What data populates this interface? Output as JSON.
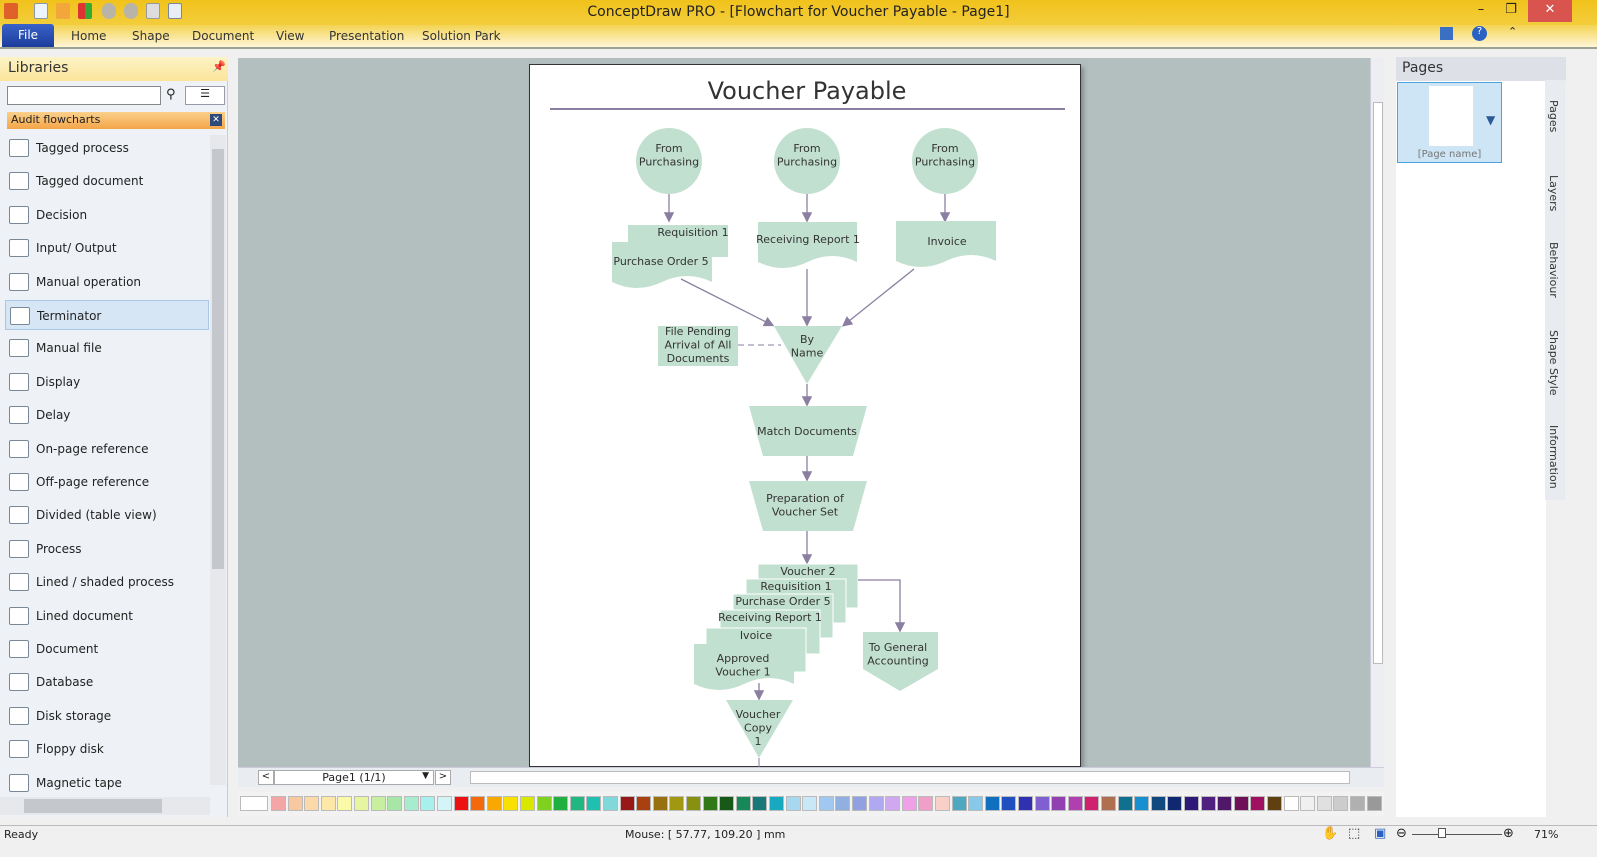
{
  "app": {
    "title": "ConceptDraw PRO - [Flowchart for Voucher Payable - Page1]"
  },
  "ribbon": {
    "file": "File",
    "tabs": [
      "Home",
      "Shape",
      "Document",
      "View",
      "Presentation",
      "Solution Park"
    ]
  },
  "window_controls": {
    "minimize": "–",
    "restore": "❐",
    "close": "✕"
  },
  "libraries": {
    "title": "Libraries",
    "search_value": "",
    "category": "Audit flowcharts",
    "items": [
      "Tagged process",
      "Tagged document",
      "Decision",
      "Input/ Output",
      "Manual operation",
      "Terminator",
      "Manual file",
      "Display",
      "Delay",
      "On-page reference",
      "Off-page reference",
      "Divided (table view)",
      "Process",
      "Lined / shaded process",
      "Lined document",
      "Document",
      "Database",
      "Disk storage",
      "Floppy disk",
      "Magnetic tape"
    ],
    "selected": "Terminator"
  },
  "diagram": {
    "title": "Voucher Payable",
    "sources": [
      "From Purchasing",
      "From Purchasing",
      "From Purchasing"
    ],
    "requisition": "Requisition 1",
    "purchase_order": "Purchase Order 5",
    "receiving_report": "Receiving Report 1",
    "invoice": "Invoice",
    "file_pending": [
      "File Pending",
      "Arrival of All",
      "Documents"
    ],
    "by_name": [
      "By",
      "Name"
    ],
    "match": "Match Documents",
    "preparation": [
      "Preparation of",
      "Voucher Set"
    ],
    "stack": [
      "Voucher 2",
      "Requisition 1",
      "Purchase Order 5",
      "Receiving Report 1",
      "Ivoice"
    ],
    "approved": [
      "Approved",
      "Voucher 1"
    ],
    "general": [
      "To General",
      "Accounting"
    ],
    "copy": [
      "Voucher",
      "Copy",
      "1"
    ],
    "fill": "#c2e0d0",
    "line": "#8a7fa0"
  },
  "navigator": {
    "prev": "<",
    "page": "Page1 (1/1)",
    "next": ">"
  },
  "palette": [
    "#f4a6a6",
    "#f8c8a0",
    "#fbd9a8",
    "#fde8a8",
    "#fafaa8",
    "#e6f5a0",
    "#c8eea0",
    "#a8e6a8",
    "#a8ecd0",
    "#a8f0ee",
    "#d4f4f8",
    "#ee1111",
    "#f46a0a",
    "#f8a800",
    "#f8e000",
    "#d8e800",
    "#80d020",
    "#20b040",
    "#20b880",
    "#20c0b0",
    "#80d8d8",
    "#981818",
    "#a84010",
    "#987010",
    "#a09810",
    "#889010",
    "#307818",
    "#185818",
    "#188858",
    "#187878",
    "#18a8c0",
    "#a8d8f0",
    "#c8e8f8",
    "#a0c8f0",
    "#90b0e0",
    "#90a0e0",
    "#b0a8f0",
    "#d0a8f0",
    "#f0a0e8",
    "#f0a0c8",
    "#f8d0c8",
    "#50a8c0",
    "#88c8e8",
    "#1070c0",
    "#2050c0",
    "#3030b0",
    "#8060d0",
    "#9040b0",
    "#b040b0",
    "#d02070",
    "#b07050",
    "#107090",
    "#1890d0",
    "#104880",
    "#102870",
    "#301878",
    "#502080",
    "#501868",
    "#701058",
    "#a01060",
    "#604010",
    "#ffffff",
    "#f0f0f0",
    "#e0e0e0",
    "#cccccc",
    "#b0b0b0",
    "#999999"
  ],
  "pages_panel": {
    "title": "Pages",
    "page_name": "[Page name]",
    "tabs": [
      "Pages",
      "Layers",
      "Behaviour",
      "Shape Style",
      "Information"
    ]
  },
  "status": {
    "ready": "Ready",
    "mouse": "Mouse: [ 57.77, 109.20 ] mm",
    "zoom": "71%"
  }
}
